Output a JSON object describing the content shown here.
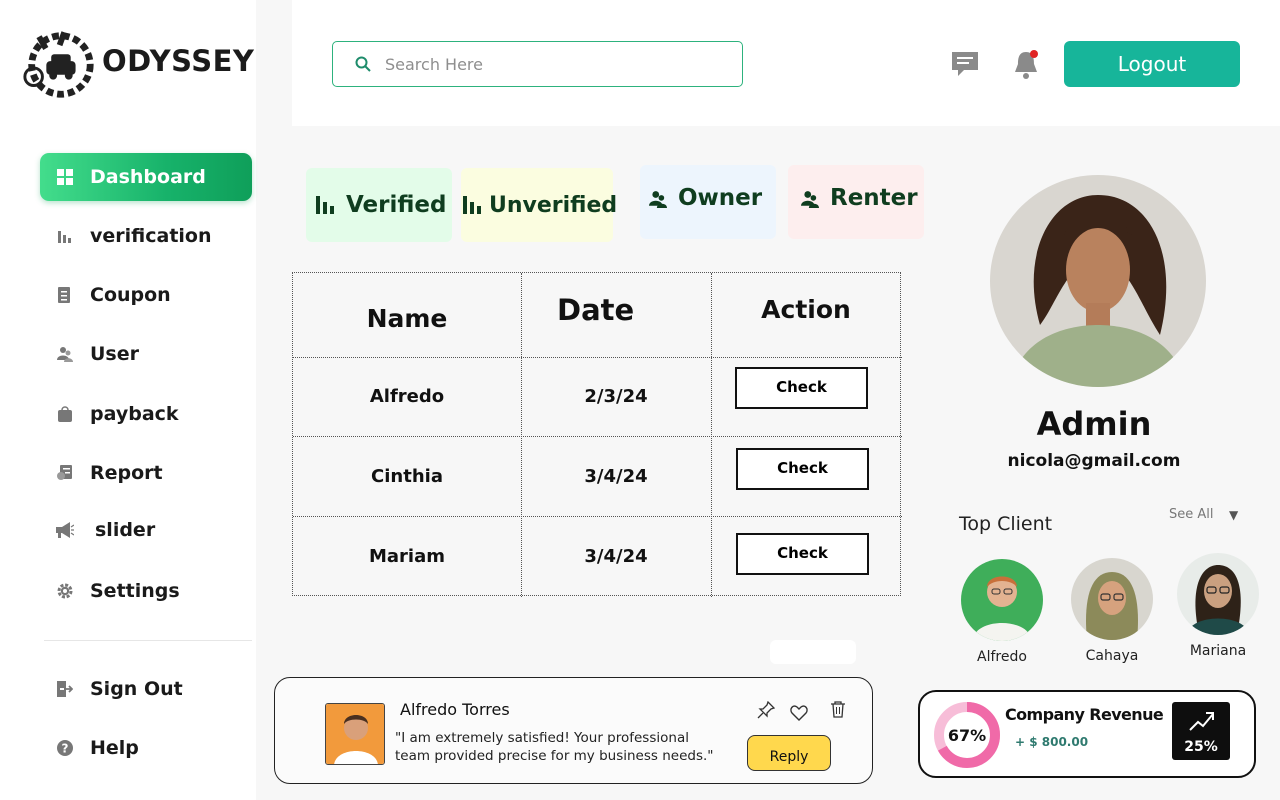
{
  "brand": {
    "name": "ODYSSEY"
  },
  "sidebar": {
    "items": [
      {
        "label": "Dashboard",
        "icon": "grid-icon",
        "active": true
      },
      {
        "label": "verification",
        "icon": "bar-chart-icon"
      },
      {
        "label": "Coupon",
        "icon": "ticket-icon"
      },
      {
        "label": "User",
        "icon": "users-icon"
      },
      {
        "label": "payback",
        "icon": "bag-icon"
      },
      {
        "label": "Report",
        "icon": "report-icon"
      },
      {
        "label": "slider",
        "icon": "megaphone-icon"
      },
      {
        "label": "Settings",
        "icon": "gear-icon"
      }
    ],
    "footer": [
      {
        "label": "Sign Out",
        "icon": "sign-out-icon"
      },
      {
        "label": "Help",
        "icon": "help-icon"
      }
    ]
  },
  "header": {
    "search_placeholder": "Search Here",
    "logout_label": "Logout"
  },
  "filters": [
    {
      "label": "Verified",
      "icon": "bar-chart-icon",
      "bg": "#e3fce9"
    },
    {
      "label": "Unverified",
      "icon": "bar-chart-icon",
      "bg": "#fbfde0"
    },
    {
      "label": "Owner",
      "icon": "users-icon",
      "bg": "#edf5fd"
    },
    {
      "label": "Renter",
      "icon": "users-icon",
      "bg": "#fdeeee"
    }
  ],
  "table": {
    "headers": [
      "Name",
      "Date",
      "Action"
    ],
    "rows": [
      {
        "name": "Alfredo",
        "date": "2/3/24",
        "action": "Check"
      },
      {
        "name": "Cinthia",
        "date": "3/4/24",
        "action": "Check"
      },
      {
        "name": "Mariam",
        "date": "3/4/24",
        "action": "Check"
      }
    ]
  },
  "review": {
    "name": "Alfredo Torres",
    "text": "\"I am extremely satisfied! Your professional team provided precise for my business needs.\"",
    "reply_label": "Reply"
  },
  "profile": {
    "role": "Admin",
    "email": "nicola@gmail.com"
  },
  "top_clients": {
    "title": "Top Client",
    "see_all": "See All",
    "clients": [
      {
        "name": "Alfredo"
      },
      {
        "name": "Cahaya"
      },
      {
        "name": "Mariana"
      }
    ]
  },
  "revenue": {
    "title": "Company Revenue",
    "percent_label": "67%",
    "percent_value": 67,
    "amount": "+ $ 800.00",
    "growth_label": "25%"
  },
  "colors": {
    "accent": "#17b59a",
    "active_nav": "#17b26a",
    "reply": "#ffd84d",
    "revenue_ring": "#f06aa8"
  }
}
